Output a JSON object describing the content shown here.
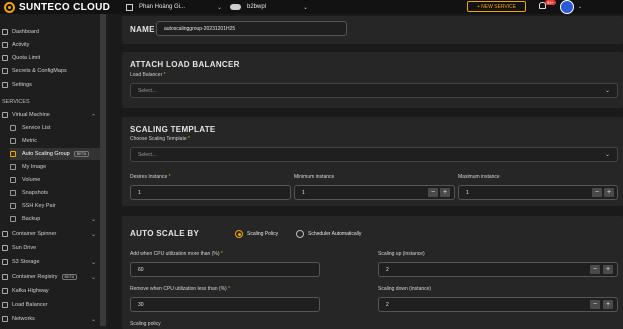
{
  "header": {
    "brand": "SUNTECO CLOUD",
    "org_name": "Phan Hoàng Gi...",
    "project_name": "b2bwpl",
    "new_service_label": "+ NEW SERVICE",
    "notif_badge": "99+"
  },
  "sidebar": {
    "top_items": [
      {
        "label": "Dashboard"
      },
      {
        "label": "Activity"
      },
      {
        "label": "Quota Limit"
      },
      {
        "label": "Secrets & ConfigMaps"
      },
      {
        "label": "Settings"
      }
    ],
    "services_label": "SERVICES",
    "vm_label": "Virtual Machine",
    "vm_sub": [
      {
        "label": "Service List"
      },
      {
        "label": "Metric"
      },
      {
        "label": "Auto Scaling Group",
        "badge": "BETA"
      },
      {
        "label": "My Image"
      },
      {
        "label": "Volume"
      },
      {
        "label": "Snapshots"
      },
      {
        "label": "SSH Key Pair"
      },
      {
        "label": "Backup"
      }
    ],
    "bottom_items": [
      {
        "label": "Container Spinner"
      },
      {
        "label": "Sun Drive"
      },
      {
        "label": "S3 Storage"
      },
      {
        "label": "Container Registry",
        "badge": "BETA"
      },
      {
        "label": "Kafka Highway"
      },
      {
        "label": "Load Balancer"
      },
      {
        "label": "Networks"
      }
    ]
  },
  "form": {
    "name_label": "NAME",
    "name_value": "autoscalinggroup-20231201H25",
    "attach_lb": {
      "title": "ATTACH LOAD BALANCER",
      "field_label": "Load Balancer",
      "placeholder": "Select..."
    },
    "template": {
      "title": "SCALING TEMPLATE",
      "field_label": "Choose Scaling Template",
      "placeholder": "Select...",
      "desires_label": "Desires Instance",
      "desires_value": "1",
      "min_label": "Minimum instance",
      "min_value": "1",
      "max_label": "Maximum instance",
      "max_value": "1"
    },
    "autoscale": {
      "title": "AUTO SCALE BY",
      "option_policy": "Scaling Policy",
      "option_auto": "Scheduler Automatically",
      "add_label": "Add when CPU utilization more than (%)",
      "add_value": "60",
      "up_label": "Scaling up (instance)",
      "up_value": "2",
      "remove_label": "Remove when CPU utilization less than (%)",
      "remove_value": "30",
      "down_label": "Scaling down (instance)",
      "down_value": "2",
      "policy_label": "Scaling policy"
    }
  },
  "stepper": {
    "minus": "−",
    "plus": "+"
  },
  "chevron": "⌄",
  "caret": "⌄",
  "colors": {
    "accent": "#f0a500",
    "background": "#1a1a1a",
    "card": "#262626"
  }
}
